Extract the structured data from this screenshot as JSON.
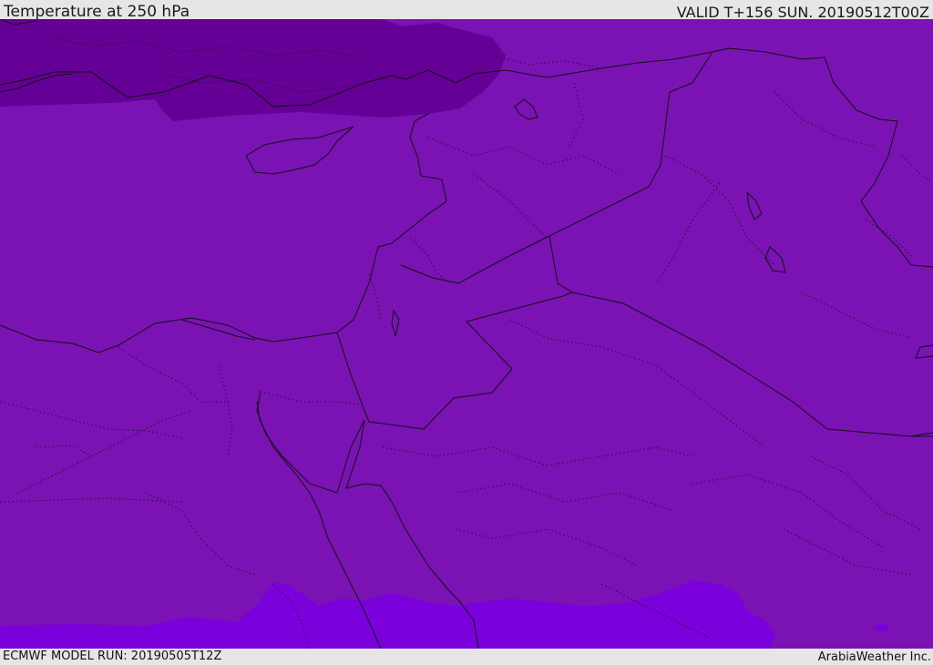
{
  "header": {
    "title": "Temperature at 250 hPa",
    "valid": "VALID T+156 SUN. 20190512T00Z"
  },
  "footer": {
    "model_run": "ECMWF MODEL RUN: 20190505T12Z",
    "credit": "ArabiaWeather Inc."
  },
  "map": {
    "colors": {
      "cold": "#640096",
      "mid": "#7a12b4",
      "warm": "#7a00dc",
      "border": "#111111"
    }
  }
}
